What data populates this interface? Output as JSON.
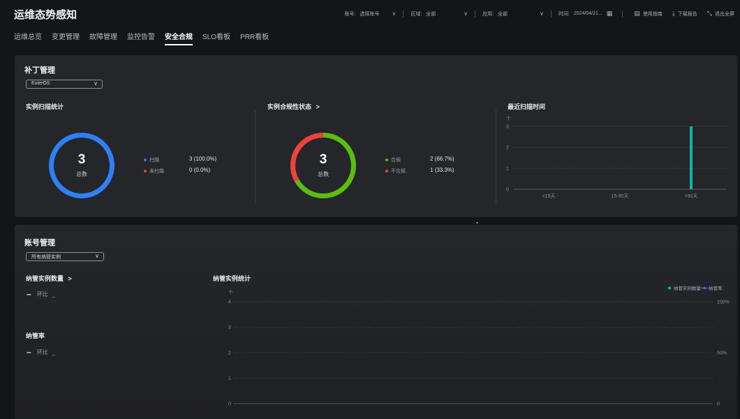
{
  "app": {
    "title": "运维态势感知"
  },
  "filters": {
    "account_label": "账号:",
    "account_value": "选择账号",
    "region_label": "区域:",
    "region_value": "全部",
    "app_label": "应用:",
    "app_value": "全部",
    "time_label": "时间:",
    "time_value": "2024/04/21...",
    "guide": "使用指南",
    "download": "下载报告",
    "exit_fullscreen": "退出全屏"
  },
  "tabs": [
    {
      "label": "运维总览"
    },
    {
      "label": "变更管理"
    },
    {
      "label": "故障管理"
    },
    {
      "label": "监控告警"
    },
    {
      "label": "安全合规",
      "active": true
    },
    {
      "label": "SLO看板"
    },
    {
      "label": "PRR看板"
    }
  ],
  "patch": {
    "title": "补丁管理",
    "os_select": "EulerOS",
    "scan_stats": {
      "title": "实例扫描统计",
      "total": "3",
      "total_label": "总数",
      "legend": [
        {
          "name": "扫描",
          "value": "3 (100.0%)",
          "color": "#2f7ff5"
        },
        {
          "name": "未扫描",
          "value": "0 (0.0%)",
          "color": "#f0413e"
        }
      ]
    },
    "compliance": {
      "title": "实例合规性状态",
      "arrow": ">",
      "total": "3",
      "total_label": "总数",
      "legend": [
        {
          "name": "合规",
          "value": "2 (66.7%)",
          "color": "#5bbd0f"
        },
        {
          "name": "不合规",
          "value": "1 (33.3%)",
          "color": "#f0413e"
        }
      ]
    },
    "recent_scan": {
      "title": "最近扫描时间"
    }
  },
  "account": {
    "title": "账号管理",
    "select": "所有纳管实例",
    "managed_count": {
      "title": "纳管实例数量",
      "arrow": ">",
      "dash": "–",
      "mom": "环比",
      "mom_val": "_"
    },
    "managed_rate": {
      "title": "纳管率",
      "dash": "–",
      "mom": "环比",
      "mom_val": "_"
    },
    "stats": {
      "title": "纳管实例统计"
    }
  },
  "chart_data": [
    {
      "type": "bar",
      "title": "最近扫描时间",
      "ylabel": "个",
      "categories": [
        "<15天",
        "15-90天",
        ">90天"
      ],
      "values": [
        0,
        0,
        3
      ],
      "ylim": [
        0,
        3
      ],
      "yticks": [
        0,
        1,
        2,
        3
      ],
      "grid": true,
      "color": "#12b3a8"
    },
    {
      "type": "line",
      "title": "纳管实例统计",
      "ylabel": "个",
      "series": [
        {
          "name": "纳管实例数量",
          "values": [],
          "color": "#12b3a8"
        },
        {
          "name": "纳管率",
          "values": [],
          "color": "#2f7ff5"
        }
      ],
      "ylim": [
        0,
        4
      ],
      "yticks": [
        0,
        1,
        2,
        3,
        4
      ],
      "y2ticks": [
        "0",
        "50%",
        "100%"
      ],
      "legend": "top-right",
      "grid": true
    }
  ]
}
